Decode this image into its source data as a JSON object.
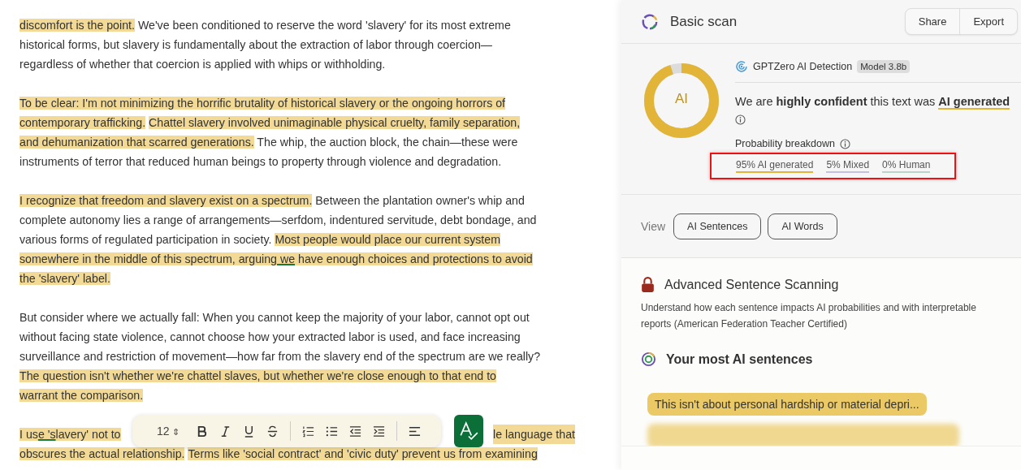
{
  "editor": {
    "paragraphs": [
      {
        "lines": [
          [
            {
              "text": "discomfort is the point.",
              "highlighted": true,
              "underlined": false
            },
            {
              "text": " We've been conditioned to reserve the word 'slavery' for its most extreme",
              "highlighted": false,
              "underlined": false
            }
          ],
          [
            {
              "text": "historical forms, but slavery is fundamentally about the extraction of labor through coercion—",
              "highlighted": false,
              "underlined": false
            }
          ],
          [
            {
              "text": "regardless of whether that coercion is applied with whips or withholding.",
              "highlighted": false,
              "underlined": false
            }
          ]
        ]
      },
      {
        "lines": [
          [
            {
              "text": "To be clear: I'm not minimizing the horrific brutality of historical slavery or the ongoing horrors of",
              "highlighted": true,
              "underlined": false
            }
          ],
          [
            {
              "text": "contemporary trafficking.",
              "highlighted": true,
              "underlined": false
            },
            {
              "text": "Chattel slavery involved unimaginable physical cruelty, family separation,",
              "highlighted": true,
              "underlined": false
            }
          ],
          [
            {
              "text": "and dehumanization that scarred generations.",
              "highlighted": true,
              "underlined": false
            },
            {
              "text": " The whip, the auction block, the chain—these were",
              "highlighted": false,
              "underlined": false
            }
          ],
          [
            {
              "text": "instruments of terror that reduced human beings to property through violence and degradation.",
              "highlighted": false,
              "underlined": false
            }
          ]
        ]
      },
      {
        "lines": [
          [
            {
              "text": "I recognize that freedom and slavery exist on a spectrum.",
              "highlighted": true,
              "underlined": false
            },
            {
              "text": " Between the plantation owner's whip and",
              "highlighted": false,
              "underlined": false
            }
          ],
          [
            {
              "text": "complete autonomy lies a range of arrangements—serfdom, indentured servitude, debt bondage, and",
              "highlighted": false,
              "underlined": false
            }
          ],
          [
            {
              "text": "various forms of regulated participation in society. ",
              "highlighted": false,
              "underlined": false
            },
            {
              "text": "Most people would place our current system",
              "highlighted": true,
              "underlined": false
            }
          ],
          [
            {
              "text": "somewhere in the middle of this spectrum, arguing",
              "highlighted": true,
              "underlined": false
            },
            {
              "text": " we",
              "highlighted": true,
              "underlined": true
            },
            {
              "text": " have enough choices and protections to avoid",
              "highlighted": true,
              "underlined": false
            }
          ],
          [
            {
              "text": "the 'slavery' label.",
              "highlighted": true,
              "underlined": false
            }
          ]
        ]
      },
      {
        "lines": [
          [
            {
              "text": "But consider where we actually fall: When you cannot keep the majority of your labor, cannot opt out",
              "highlighted": false,
              "underlined": false
            }
          ],
          [
            {
              "text": "without facing state violence, cannot choose how your extracted labor is used, and face increasing",
              "highlighted": false,
              "underlined": false
            }
          ],
          [
            {
              "text": "surveillance and restriction of movement—how far from the slavery end of the spectrum are we really?",
              "highlighted": false,
              "underlined": false
            }
          ],
          [
            {
              "text": "The question isn't whether we're chattel slaves, but whether we're close enough to that end to",
              "highlighted": true,
              "underlined": false
            }
          ],
          [
            {
              "text": "warrant the comparison.",
              "highlighted": true,
              "underlined": false
            }
          ]
        ]
      },
      {
        "lines": [
          [
            {
              "text": "I us",
              "highlighted": true,
              "underlined": false
            },
            {
              "text": "e 's",
              "highlighted": true,
              "underlined": true
            },
            {
              "text": "lavery' not to",
              "highlighted": true,
              "underlined": false
            },
            {
              "text": "le language that",
              "highlighted": true,
              "underlined": false,
              "gap": true
            }
          ],
          [
            {
              "text": "obscures the actual relationship.",
              "highlighted": true,
              "underlined": false
            },
            {
              "text": "Terms like 'social contract' and 'civic duty' prevent us from examining",
              "highlighted": true,
              "underlined": false
            }
          ]
        ]
      }
    ]
  },
  "toolbar": {
    "font_size": "12",
    "arrows": "⇕"
  },
  "panel": {
    "title": "Basic scan",
    "actions": [
      "Share",
      "Export"
    ],
    "result": {
      "label": "AI",
      "level": 0.95,
      "detector": "GPTZero AI Detection",
      "model": "Model 3.8b",
      "verdict": "We are **highly confident** this text was",
      "verdict_emphasis": "AI generated",
      "breakdown_title": "Probability breakdown",
      "annotated": true,
      "breakdown": [
        {
          "text": "95% AI generated",
          "color": "#e2b538"
        },
        {
          "text": "5% Mixed",
          "color": "#c7bfe0"
        },
        {
          "text": "0% Human",
          "color": "#b9d7c7"
        }
      ]
    },
    "view": {
      "label": "View",
      "buttons": [
        "AI Sentences",
        "AI Words"
      ]
    },
    "advanced": {
      "title": "Advanced Sentence Scanning",
      "description": "Understand how each sentence impacts AI probabilities and with interpretable reports (American Federation Teacher Certified)"
    },
    "sentences": {
      "title": "Your most AI sentences",
      "items": [
        "This isn't about personal hardship or material depri..."
      ]
    }
  }
}
